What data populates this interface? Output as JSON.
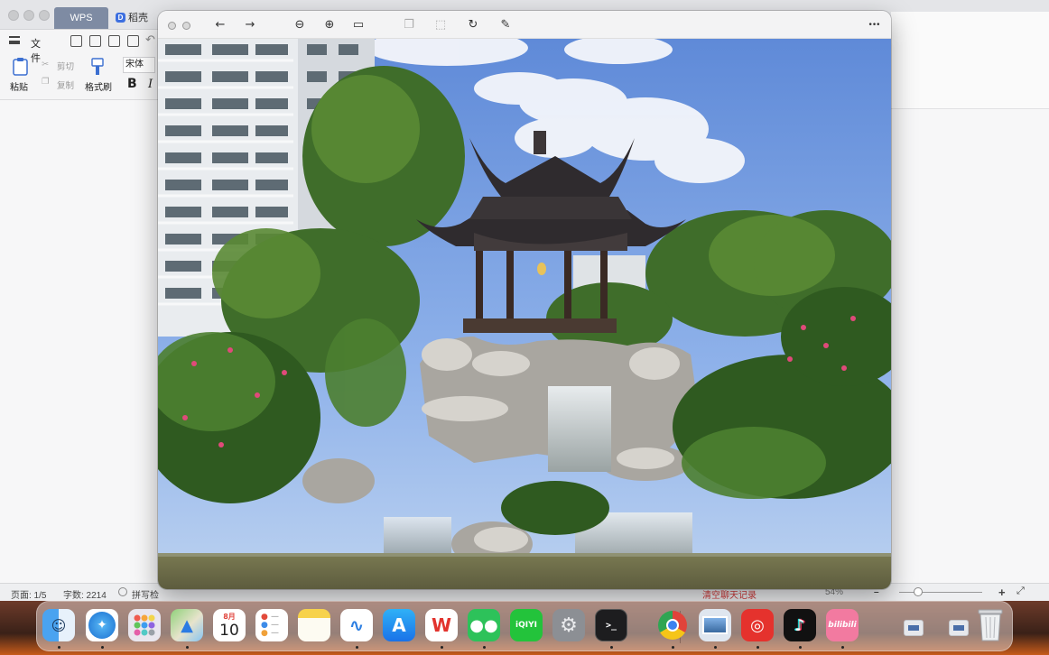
{
  "wps": {
    "tabs": [
      {
        "label": "WPS"
      },
      {
        "label": "稻壳"
      }
    ],
    "menu": {
      "file_label": "文件"
    },
    "ribbon": {
      "paste": "粘贴",
      "cut": "剪切",
      "copy": "复制",
      "format_painter": "格式刷",
      "font_name": "宋体",
      "bold": "B",
      "italic": "I"
    },
    "status": {
      "page": "页面: 1/5",
      "word_count": "字数: 2214",
      "spellcheck": "拼写检",
      "chat_hint": "清空聊天记录",
      "zoom": "54%",
      "zoom_out": "–",
      "zoom_in": "+"
    }
  },
  "preview": {
    "toolbar_icons": [
      "back-icon",
      "forward-icon",
      "zoom-out-icon",
      "zoom-in-icon",
      "fit-icon",
      "page-icon",
      "crop-select-icon",
      "rotate-icon",
      "markup-icon",
      "more-icon"
    ],
    "more_label": "•••",
    "photo_subject": "Chinese garden pavilion on rockery with waterfall, pond and high-rise building"
  },
  "dock": {
    "calendar_month": "8月",
    "calendar_day": "10",
    "wps_label": "W",
    "iqiyi_label": "iQIYI",
    "bilibili_label": "bilibili",
    "terminal_label": ">_"
  },
  "colors": {
    "wps_tab": "#7e8ba3",
    "sky": "#6f98de",
    "pavilion_roof": "#2f2b2e",
    "status_red": "#d23c3c"
  }
}
